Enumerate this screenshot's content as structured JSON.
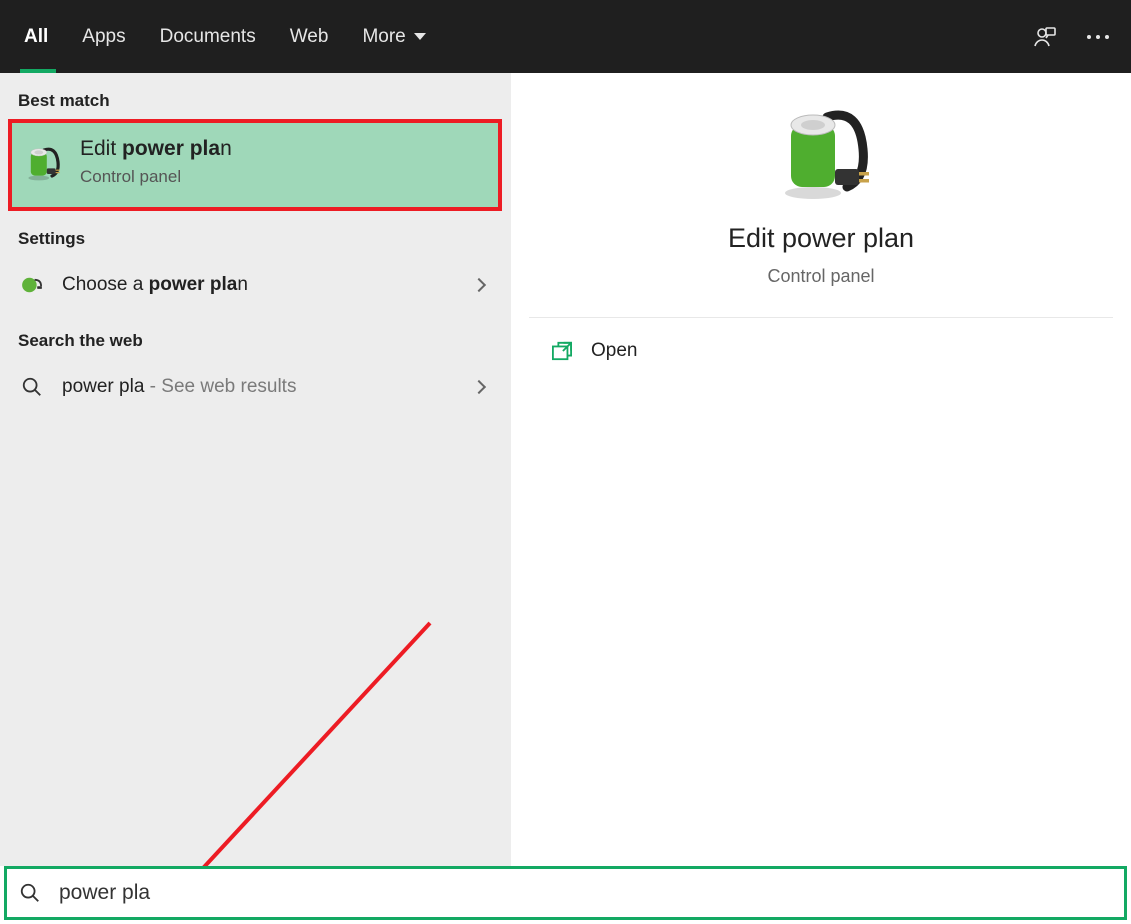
{
  "topbar": {
    "tabs": [
      "All",
      "Apps",
      "Documents",
      "Web",
      "More"
    ],
    "active_index": 0
  },
  "left": {
    "best_match_header": "Best match",
    "best_match": {
      "title_pre": "Edit ",
      "title_bold": "power pla",
      "title_post": "n",
      "subtitle": "Control panel"
    },
    "settings_header": "Settings",
    "settings_item": {
      "pre": "Choose a ",
      "bold": "power pla",
      "post": "n"
    },
    "web_header": "Search the web",
    "web_item": {
      "query": "power pla",
      "suffix": " - See web results"
    }
  },
  "right": {
    "title": "Edit power plan",
    "subtitle": "Control panel",
    "open_label": "Open"
  },
  "search": {
    "value": "power pla"
  },
  "colors": {
    "accent": "#13a963",
    "highlight_border": "#ed1c24",
    "highlight_fill": "#9fd8b9"
  }
}
